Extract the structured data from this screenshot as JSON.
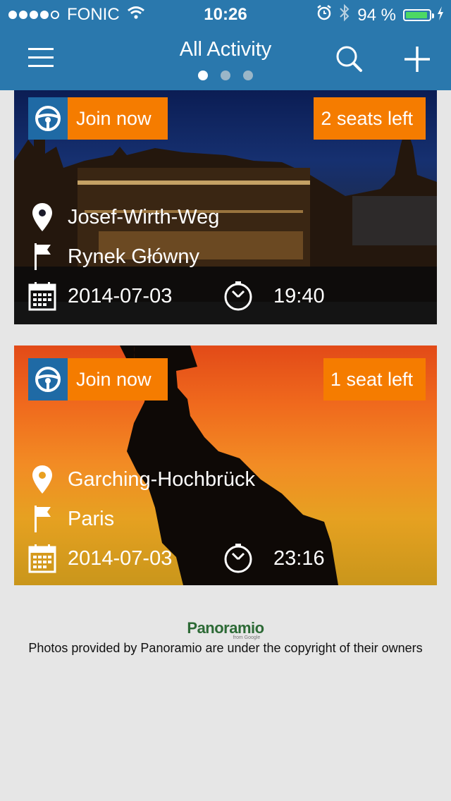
{
  "status_bar": {
    "carrier": "FONIC",
    "time": "10:26",
    "battery_percent": "94 %",
    "battery_level": 0.94,
    "signal_bars_filled": 4,
    "signal_bars_total": 5
  },
  "navbar": {
    "title": "All Activity",
    "pages_total": 3,
    "active_page": 1
  },
  "rides": [
    {
      "join_label": "Join now",
      "seats_label": "2 seats left",
      "from": "Josef-Wirth-Weg",
      "to": "Rynek Główny",
      "date": "2014-07-03",
      "time": "19:40"
    },
    {
      "join_label": "Join now",
      "seats_label": "1 seat left",
      "from": "Garching-Hochbrück",
      "to": "Paris",
      "date": "2014-07-03",
      "time": "23:16"
    }
  ],
  "footer": {
    "logo_text": "Panoramio",
    "logo_sub": "from Google",
    "credit": "Photos provided by Panoramio are under the copyright of their owners"
  },
  "colors": {
    "navbar": "#2a78ad",
    "join_orange": "#f57c00",
    "wheel_blue": "#1f6aa5",
    "background": "#e6e6e6",
    "battery_green": "#4cd964"
  },
  "icons": [
    "menu-icon",
    "search-icon",
    "add-icon",
    "steering-wheel-icon",
    "location-pin-icon",
    "flag-icon",
    "calendar-icon",
    "clock-icon",
    "wifi-icon",
    "alarm-icon",
    "bluetooth-icon",
    "charging-icon"
  ]
}
